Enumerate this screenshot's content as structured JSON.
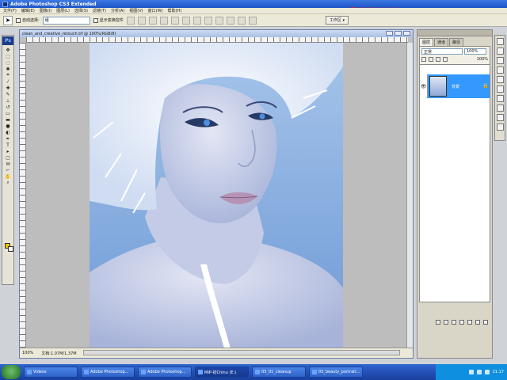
{
  "app": {
    "title": "Adobe Photoshop CS3 Extended"
  },
  "watermark": "思缘设计论坛 www.MISSVUAN.COM",
  "menu": [
    "文件(F)",
    "编辑(E)",
    "图像(I)",
    "图层(L)",
    "选择(S)",
    "滤镜(T)",
    "分析(A)",
    "视图(V)",
    "窗口(W)",
    "帮助(H)"
  ],
  "options": {
    "auto_select": "自动选择:",
    "auto_select_value": "组",
    "show_transform": "显示变换控件",
    "workspace": "工作区 ▾"
  },
  "document": {
    "title": "clean_and_creative_retouch.tif @ 100%(RGB/8)",
    "zoom": "100%",
    "doc_info": "文档:1.07M/1.37M"
  },
  "panel": {
    "tabs": [
      "图层",
      "通道",
      "路径"
    ],
    "blend_mode": "正常",
    "opacity_label": "不透明度:",
    "opacity": "100%",
    "lock_label": "锁定:",
    "fill_label": "填充:",
    "fill": "100%",
    "layer_name": "背景"
  },
  "taskbar": {
    "items": [
      "Videos",
      "Adobe Photoshop...",
      "Adobe Photoshop...",
      "MIP-初Chinu (E:)",
      "03_01_cleanup",
      "03_beauty_portrait..."
    ],
    "clock": "21:17"
  }
}
